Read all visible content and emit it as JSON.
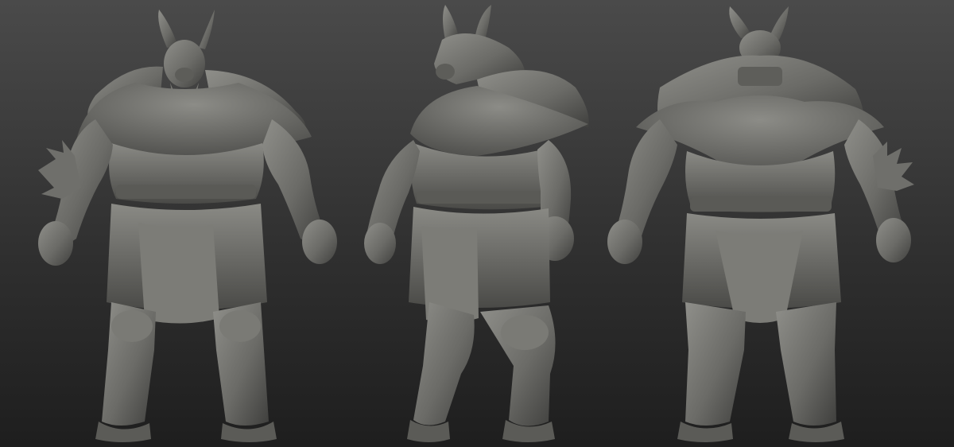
{
  "scene": {
    "background_top": "#4a4a4a",
    "background_bottom": "#1e1e1e",
    "clay_light": "#8b8b86",
    "clay_mid": "#6c6c68",
    "clay_dark": "#454543",
    "clay_shadow": "#2f2f2d"
  },
  "views": [
    {
      "name": "front-view"
    },
    {
      "name": "three-quarter-view"
    },
    {
      "name": "back-view"
    }
  ]
}
